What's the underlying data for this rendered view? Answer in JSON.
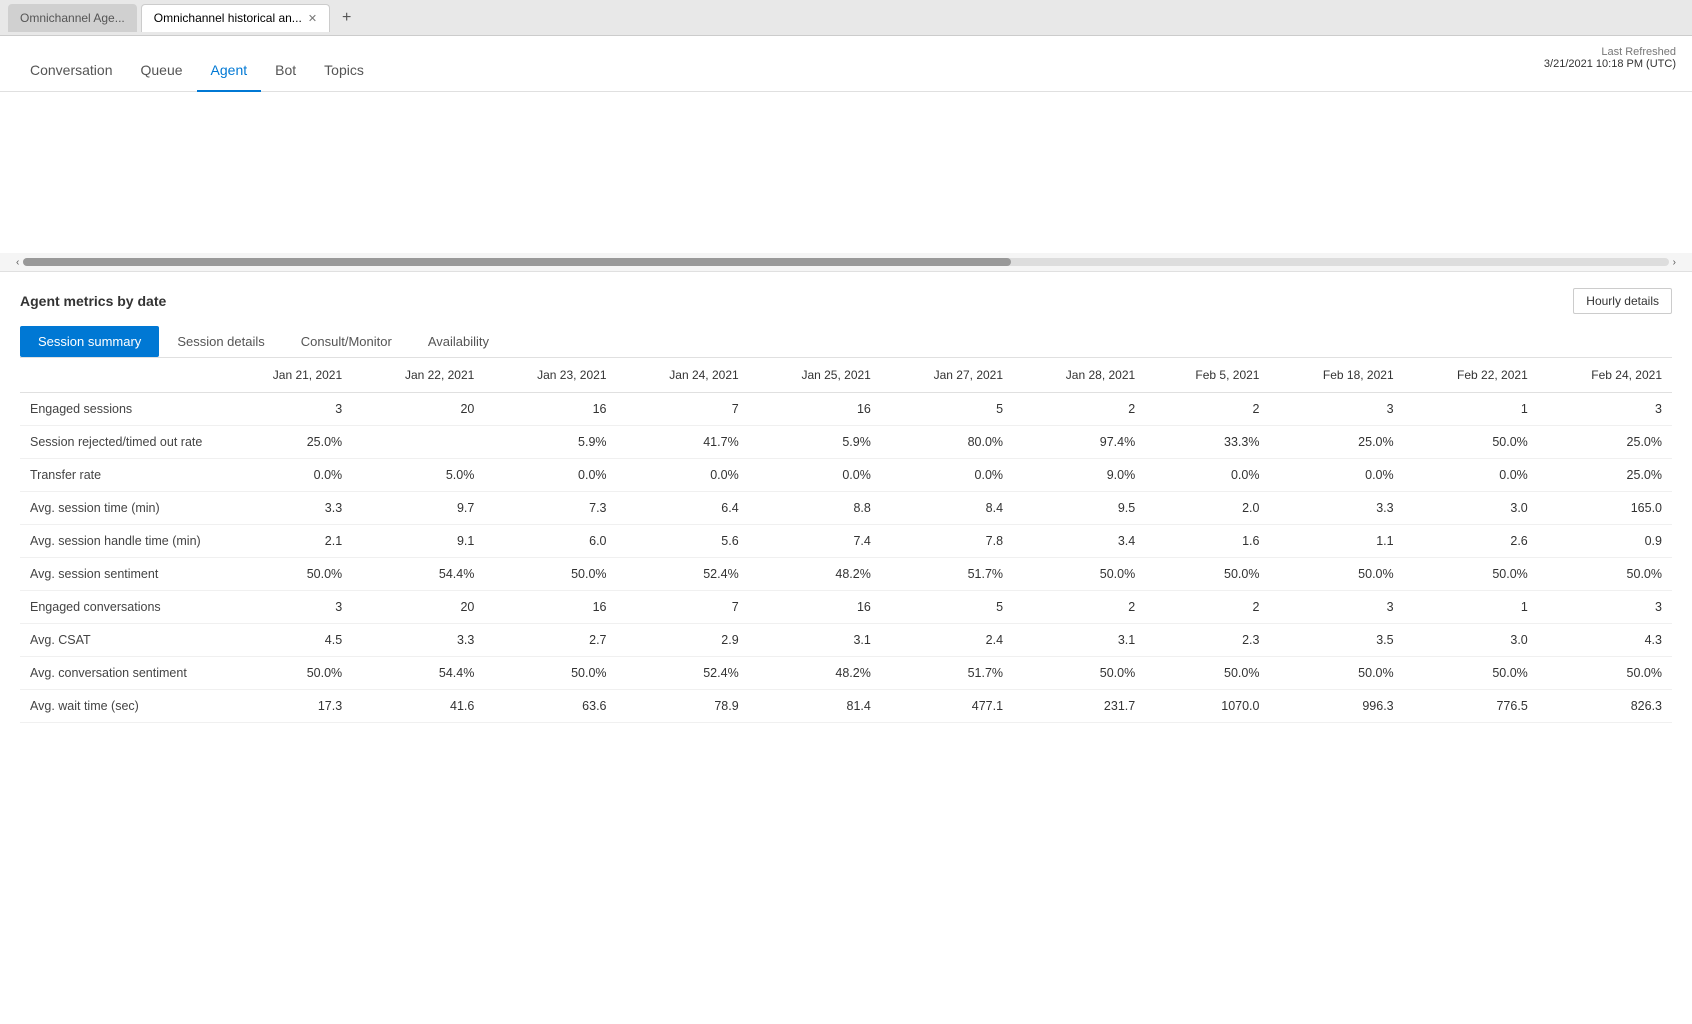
{
  "browser": {
    "tabs": [
      {
        "label": "Omnichannel Age...",
        "active": false
      },
      {
        "label": "Omnichannel historical an...",
        "active": true
      }
    ],
    "new_tab_label": "+"
  },
  "nav": {
    "items": [
      "Conversation",
      "Queue",
      "Agent",
      "Bot",
      "Topics"
    ],
    "active": "Agent"
  },
  "last_refreshed": {
    "label": "Last Refreshed",
    "value": "3/21/2021 10:18 PM (UTC)"
  },
  "metrics_section": {
    "title": "Agent metrics by date",
    "hourly_button": "Hourly details"
  },
  "sub_tabs": [
    "Session summary",
    "Session details",
    "Consult/Monitor",
    "Availability"
  ],
  "active_sub_tab": "Session summary",
  "table": {
    "columns": [
      "Jan 21, 2021",
      "Jan 22, 2021",
      "Jan 23, 2021",
      "Jan 24, 2021",
      "Jan 25, 2021",
      "Jan 27, 2021",
      "Jan 28, 2021",
      "Feb 5, 2021",
      "Feb 18, 2021",
      "Feb 22, 2021",
      "Feb 24, 2021"
    ],
    "rows": [
      {
        "label": "Engaged sessions",
        "values": [
          "3",
          "20",
          "16",
          "7",
          "16",
          "5",
          "2",
          "2",
          "3",
          "1",
          "3"
        ]
      },
      {
        "label": "Session rejected/timed out rate",
        "values": [
          "25.0%",
          "",
          "5.9%",
          "41.7%",
          "5.9%",
          "80.0%",
          "97.4%",
          "33.3%",
          "25.0%",
          "50.0%",
          "25.0%"
        ]
      },
      {
        "label": "Transfer rate",
        "values": [
          "0.0%",
          "5.0%",
          "0.0%",
          "0.0%",
          "0.0%",
          "0.0%",
          "9.0%",
          "0.0%",
          "0.0%",
          "0.0%",
          "25.0%"
        ]
      },
      {
        "label": "Avg. session time (min)",
        "values": [
          "3.3",
          "9.7",
          "7.3",
          "6.4",
          "8.8",
          "8.4",
          "9.5",
          "2.0",
          "3.3",
          "3.0",
          "165.0"
        ]
      },
      {
        "label": "Avg. session handle time (min)",
        "values": [
          "2.1",
          "9.1",
          "6.0",
          "5.6",
          "7.4",
          "7.8",
          "3.4",
          "1.6",
          "1.1",
          "2.6",
          "0.9"
        ]
      },
      {
        "label": "Avg. session sentiment",
        "values": [
          "50.0%",
          "54.4%",
          "50.0%",
          "52.4%",
          "48.2%",
          "51.7%",
          "50.0%",
          "50.0%",
          "50.0%",
          "50.0%",
          "50.0%"
        ]
      },
      {
        "label": "Engaged conversations",
        "values": [
          "3",
          "20",
          "16",
          "7",
          "16",
          "5",
          "2",
          "2",
          "3",
          "1",
          "3"
        ]
      },
      {
        "label": "Avg. CSAT",
        "values": [
          "4.5",
          "3.3",
          "2.7",
          "2.9",
          "3.1",
          "2.4",
          "3.1",
          "2.3",
          "3.5",
          "3.0",
          "4.3"
        ]
      },
      {
        "label": "Avg. conversation sentiment",
        "values": [
          "50.0%",
          "54.4%",
          "50.0%",
          "52.4%",
          "48.2%",
          "51.7%",
          "50.0%",
          "50.0%",
          "50.0%",
          "50.0%",
          "50.0%"
        ]
      },
      {
        "label": "Avg. wait time (sec)",
        "values": [
          "17.3",
          "41.6",
          "63.6",
          "78.9",
          "81.4",
          "477.1",
          "231.7",
          "1070.0",
          "996.3",
          "776.5",
          "826.3"
        ]
      }
    ]
  }
}
